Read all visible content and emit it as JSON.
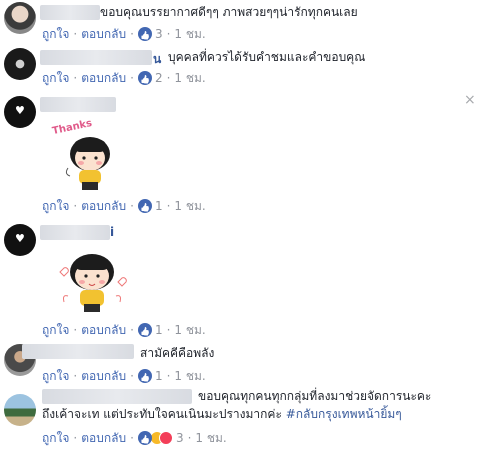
{
  "comments": [
    {
      "id": "c1",
      "text": "ขอบคุณบรรยากาศดีๆๆ ภาพสวยๆๆน่ารักทุกคนเลย",
      "like_label": "ถูกใจ",
      "reply_label": "ตอบกลับ",
      "reactions": "3",
      "time": "1 ชม."
    },
    {
      "id": "c2",
      "name_tail": "น",
      "text": "บุคคลที่ควรได้รับคำชมและคำขอบคุณ",
      "like_label": "ถูกใจ",
      "reply_label": "ตอบกลับ",
      "reactions": "2",
      "time": "1 ชม."
    },
    {
      "id": "c3",
      "sticker_text": "Thanks",
      "like_label": "ถูกใจ",
      "reply_label": "ตอบกลับ",
      "reactions": "1",
      "time": "1 ชม."
    },
    {
      "id": "c4",
      "name_tail": "i",
      "like_label": "ถูกใจ",
      "reply_label": "ตอบกลับ",
      "reactions": "1",
      "time": "1 ชม."
    },
    {
      "id": "c5",
      "text": "สามัคคีคือพลัง",
      "like_label": "ถูกใจ",
      "reply_label": "ตอบกลับ",
      "reactions": "1",
      "time": "1 ชม."
    },
    {
      "id": "c6",
      "text_line1": "ขอบคุณทุกคนทุกกลุ่มที่ลงมาช่วยจัดการนะคะ",
      "text_line2_plain": "ถึงเค้าจะเท แต่ประทับใจคนเนินมะปรางมากค่ะ ",
      "hashtag": "#กลับกรุงเทพหน้ายิ้มๆ",
      "like_label": "ถูกใจ",
      "reply_label": "ตอบกลับ",
      "reactions": "3",
      "time": "1 ชม."
    }
  ],
  "close_icon": "×",
  "colors": {
    "link": "#4267b2",
    "name": "#365899",
    "meta": "#90949c",
    "like": "#4267b2"
  }
}
